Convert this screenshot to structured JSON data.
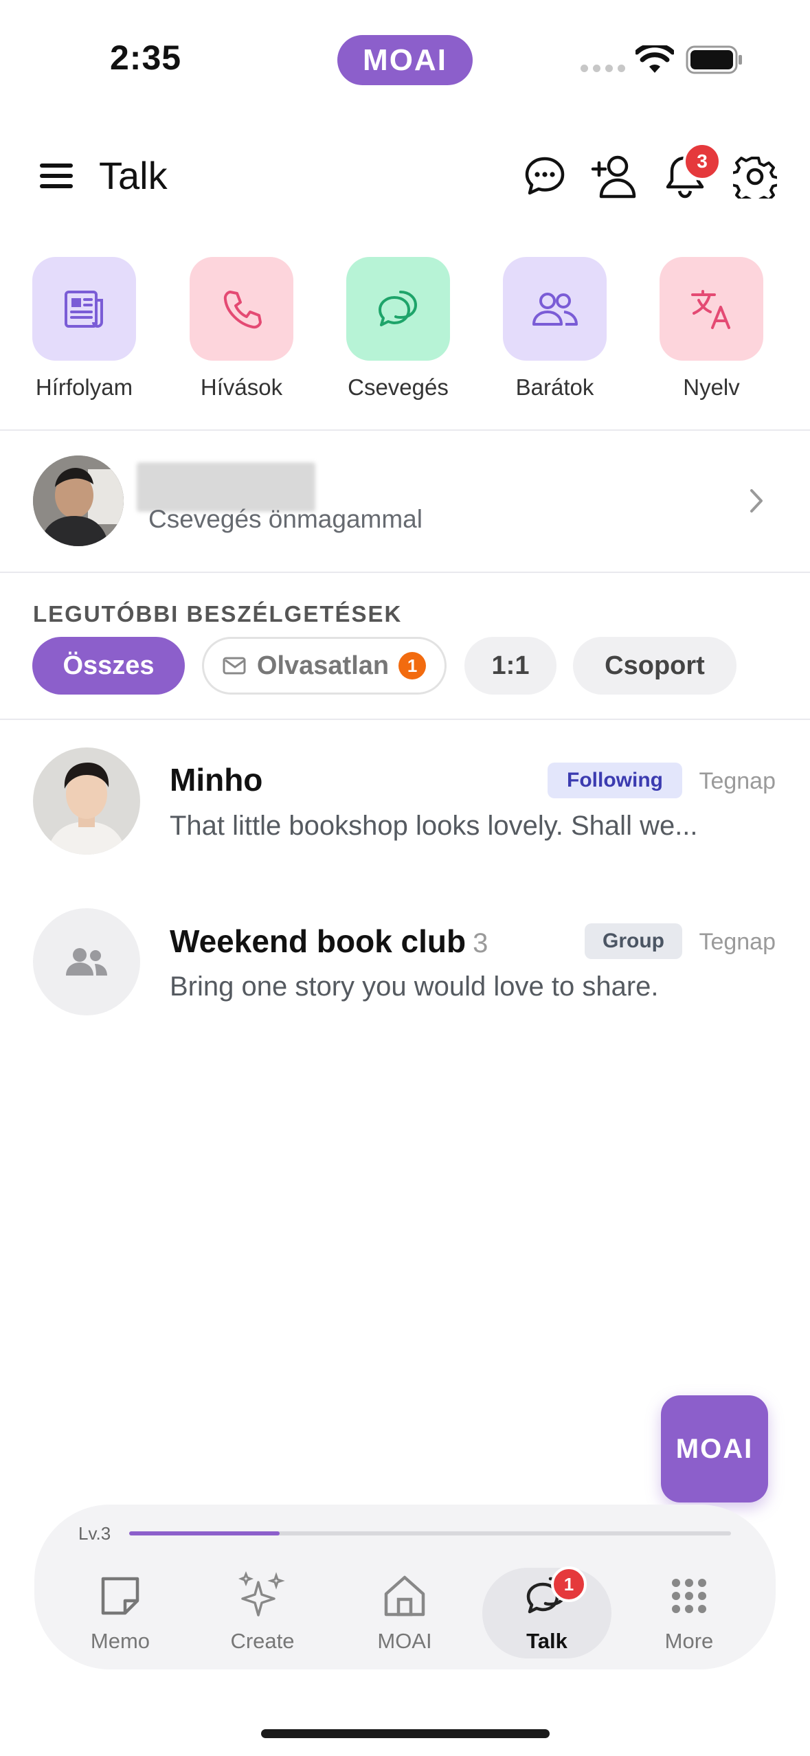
{
  "status_bar": {
    "time": "2:35",
    "brand": "MOAI"
  },
  "header": {
    "title": "Talk",
    "notifications_badge": "3"
  },
  "quick_actions": [
    {
      "label": "Hírfolyam",
      "icon": "newspaper-icon",
      "bg": "#e4dcfb",
      "fg": "#7a5cd6"
    },
    {
      "label": "Hívások",
      "icon": "phone-icon",
      "bg": "#fdd5dc",
      "fg": "#e44a73"
    },
    {
      "label": "Csevegés",
      "icon": "chat-bubble-icon",
      "bg": "#b7f3d6",
      "fg": "#1ea46a"
    },
    {
      "label": "Barátok",
      "icon": "friends-icon",
      "bg": "#e4dcfb",
      "fg": "#7a5cd6"
    },
    {
      "label": "Nyelv",
      "icon": "translate-icon",
      "bg": "#fdd5dc",
      "fg": "#e44a73"
    }
  ],
  "self_chat": {
    "subtitle": "Csevegés önmagammal"
  },
  "recent": {
    "title": "LEGUTÓBBI BESZÉLGETÉSEK",
    "filters": {
      "all": "Összes",
      "unread": "Olvasatlan",
      "unread_count": "1",
      "one_to_one": "1:1",
      "group": "Csoport"
    }
  },
  "conversations": [
    {
      "name": "Minho",
      "count": "",
      "tag": "Following",
      "time": "Tegnap",
      "message": "That little bookshop looks lovely. Shall we..."
    },
    {
      "name": "Weekend book club",
      "count": "3",
      "tag": "Group",
      "time": "Tegnap",
      "message": "Bring one story you would love to share."
    }
  ],
  "fab": {
    "label": "MOAI"
  },
  "progress": {
    "level": "Lv.3",
    "fraction": 0.25
  },
  "bottom_nav": {
    "memo": "Memo",
    "create": "Create",
    "moai": "MOAI",
    "talk": "Talk",
    "talk_badge": "1",
    "more": "More"
  },
  "colors": {
    "accent": "#8c5fcb",
    "badge": "#e5393c",
    "unread_badge": "#f26b0f"
  }
}
